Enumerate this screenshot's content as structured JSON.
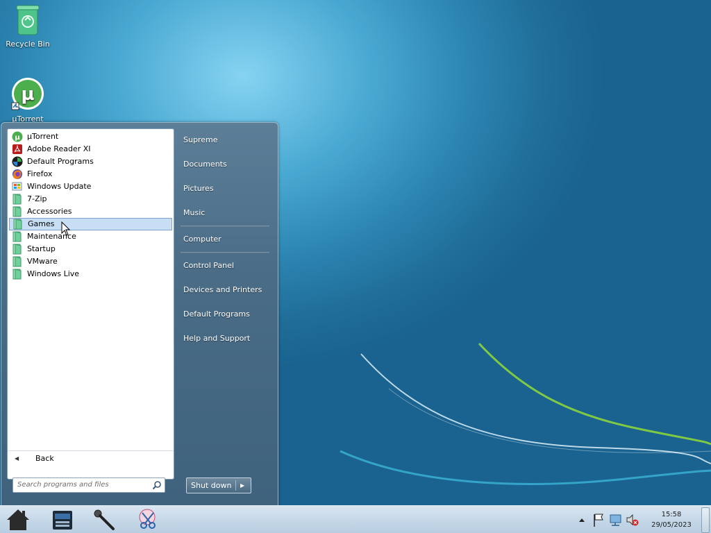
{
  "desktop": {
    "icons": [
      {
        "label": "Recycle Bin",
        "icon": "recycle-bin-icon"
      },
      {
        "label": "µTorrent",
        "icon": "utorrent-icon"
      }
    ]
  },
  "start_menu": {
    "programs": [
      {
        "label": "µTorrent",
        "icon": "utorrent-icon"
      },
      {
        "label": "Adobe Reader XI",
        "icon": "adobe-reader-icon"
      },
      {
        "label": "Default Programs",
        "icon": "default-programs-icon"
      },
      {
        "label": "Firefox",
        "icon": "firefox-icon"
      },
      {
        "label": "Windows Update",
        "icon": "windows-update-icon"
      },
      {
        "label": "7-Zip",
        "icon": "folder-icon"
      },
      {
        "label": "Accessories",
        "icon": "folder-icon"
      },
      {
        "label": "Games",
        "icon": "folder-icon",
        "selected": true
      },
      {
        "label": "Maintenance",
        "icon": "folder-icon"
      },
      {
        "label": "Startup",
        "icon": "folder-icon"
      },
      {
        "label": "VMware",
        "icon": "folder-icon"
      },
      {
        "label": "Windows Live",
        "icon": "folder-icon"
      }
    ],
    "back_label": "Back",
    "search_placeholder": "Search programs and files",
    "right_items": [
      "Supreme",
      "Documents",
      "Pictures",
      "Music",
      "Computer",
      "Control Panel",
      "Devices and Printers",
      "Default Programs",
      "Help and Support"
    ],
    "shutdown_label": "Shut down"
  },
  "taskbar": {
    "pinned": [
      "home-icon",
      "file-manager-icon",
      "microphone-icon",
      "snipping-tool-icon"
    ],
    "clock": {
      "time": "15:58",
      "date": "29/05/2023"
    }
  },
  "colors": {
    "accent_green": "#78c43a",
    "selection": "#c8def4"
  }
}
